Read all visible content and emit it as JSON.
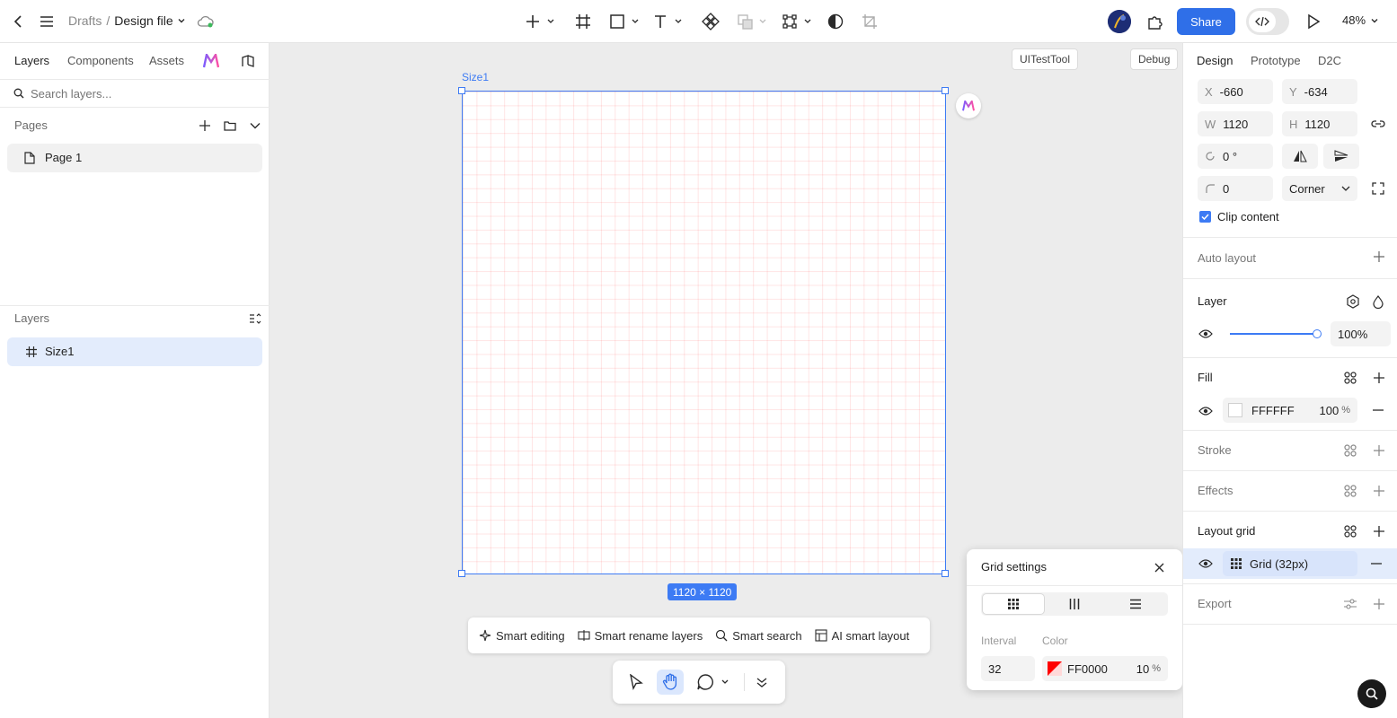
{
  "topbar": {
    "breadcrumb_parent": "Drafts",
    "breadcrumb_sep": "/",
    "file_name": "Design file",
    "share_label": "Share",
    "zoom": "48%"
  },
  "left": {
    "tabs": [
      "Layers",
      "Components",
      "Assets"
    ],
    "search_placeholder": "Search layers...",
    "pages_title": "Pages",
    "pages": [
      "Page 1"
    ],
    "layers_title": "Layers",
    "layers": [
      "Size1"
    ]
  },
  "canvas": {
    "frame_name": "Size1",
    "frame_size": "1120 × 1120",
    "uitesttool": "UITestTool",
    "debug": "Debug",
    "smart_bar": [
      "Smart editing",
      "Smart rename layers",
      "Smart search",
      "AI smart layout"
    ]
  },
  "grid_popup": {
    "title": "Grid settings",
    "interval_label": "Interval",
    "color_label": "Color",
    "interval": "32",
    "color_hex": "FF0000",
    "opacity": "10",
    "opacity_unit": "%"
  },
  "right": {
    "tabs": [
      "Design",
      "Prototype",
      "D2C"
    ],
    "x_label": "X",
    "x": "-660",
    "y_label": "Y",
    "y": "-634",
    "w_label": "W",
    "w": "1120",
    "h_label": "H",
    "h": "1120",
    "rotation": "0 °",
    "radius": "0",
    "corner": "Corner",
    "clip_content": "Clip content",
    "auto_layout": "Auto layout",
    "layer": "Layer",
    "layer_opacity": "100%",
    "layer_opacity_value": 1.0,
    "fill": "Fill",
    "fill_hex": "FFFFFF",
    "fill_opacity": "100",
    "fill_opacity_unit": "%",
    "stroke": "Stroke",
    "effects": "Effects",
    "layout_grid": "Layout grid",
    "grid_item": "Grid (32px)",
    "export": "Export"
  },
  "colors": {
    "accent": "#3d7bf4",
    "share_bg": "#2f6fe8",
    "grid_color": "#ff0000"
  }
}
